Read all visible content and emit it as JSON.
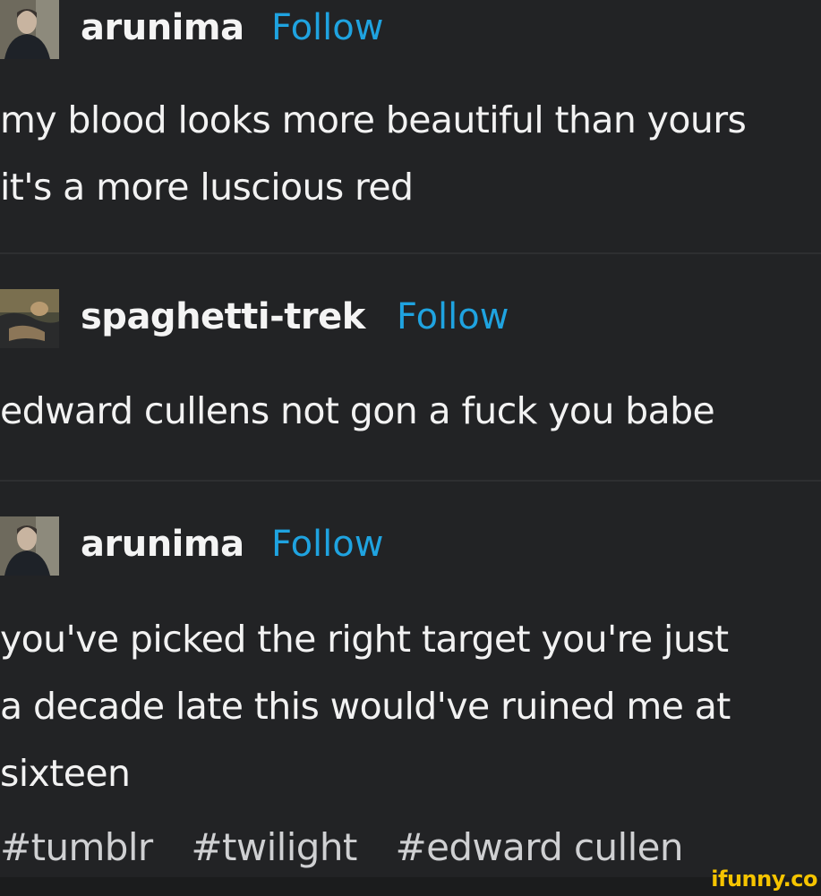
{
  "posts": [
    {
      "username": "arunima",
      "follow_label": "Follow",
      "text": "my blood looks more beautiful than yours\nit's a more luscious red"
    },
    {
      "username": "spaghetti-trek",
      "follow_label": "Follow",
      "text": "edward cullens not gon a fuck you babe"
    },
    {
      "username": "arunima",
      "follow_label": "Follow",
      "text": "you've picked the right target you're just\na decade late this would've ruined me at\nsixteen"
    }
  ],
  "tags": [
    "#tumblr",
    "#twilight",
    "#edward cullen"
  ],
  "watermark": "ifunny.co",
  "colors": {
    "background": "#222325",
    "follow": "#1fa3e0",
    "watermark": "#f5c400"
  }
}
